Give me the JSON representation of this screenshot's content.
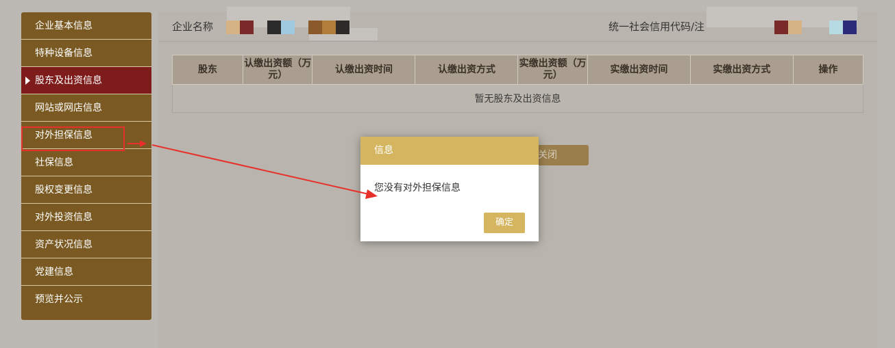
{
  "sidebar": {
    "items": [
      {
        "label": "企业基本信息"
      },
      {
        "label": "特种设备信息"
      },
      {
        "label": "股东及出资信息",
        "active": true
      },
      {
        "label": "网站或网店信息"
      },
      {
        "label": "对外担保信息"
      },
      {
        "label": "社保信息"
      },
      {
        "label": "股权变更信息"
      },
      {
        "label": "对外投资信息"
      },
      {
        "label": "资产状况信息"
      },
      {
        "label": "党建信息"
      },
      {
        "label": "预览并公示"
      }
    ]
  },
  "infobar": {
    "company_label": "企业名称",
    "credit_label": "统一社会信用代码/注",
    "redaction_colors": [
      "#d6b385",
      "#7b2a2a",
      "#2b2b2b",
      "#9ec9df",
      "#8a5a2b",
      "#b07d3a",
      "#2e2a2a",
      "#7b2a2a",
      "#d6b385",
      "#b7dbe2",
      "#2c2c7a"
    ]
  },
  "table": {
    "headers": [
      "股东",
      "认缴出资额（万元）",
      "认缴出资时间",
      "认缴出资方式",
      "实缴出资额（万元）",
      "实缴出资时间",
      "实缴出资方式",
      "操作"
    ],
    "empty_message": "暂无股东及出资信息"
  },
  "close_button": "关闭",
  "dialog": {
    "title": "信息",
    "message": "您没有对外担保信息",
    "ok_label": "确定"
  },
  "colors": {
    "sidebar_bg": "#7a5a22",
    "sidebar_active": "#7e1b1b",
    "accent": "#d5b560",
    "annotation_red": "#e8302a"
  }
}
